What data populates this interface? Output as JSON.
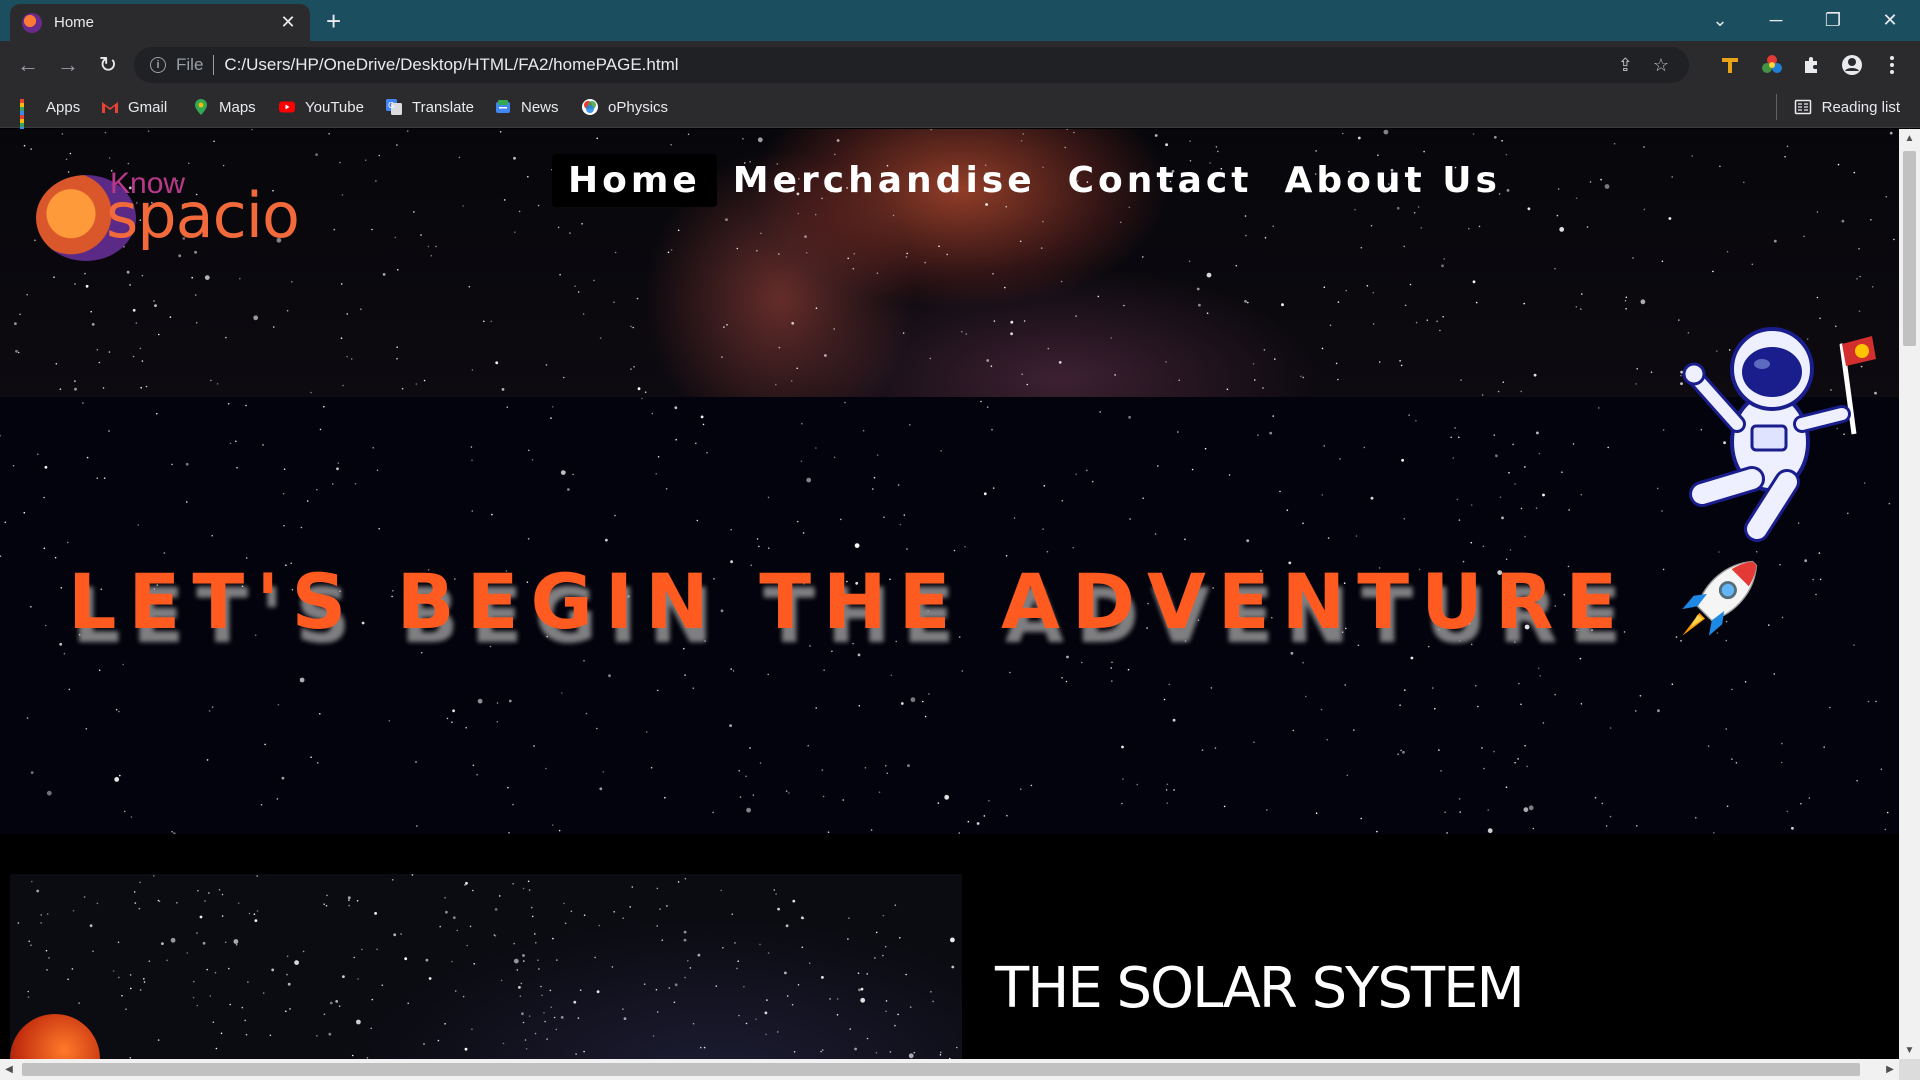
{
  "browser": {
    "tab": {
      "title": "Home",
      "close": "✕"
    },
    "new_tab": "+",
    "window_controls": {
      "list": "⌄",
      "minimize": "─",
      "restore": "❐",
      "close": "✕"
    },
    "nav": {
      "back": "←",
      "forward": "→",
      "reload": "↻"
    },
    "address": {
      "scheme": "File",
      "url": "C:/Users/HP/OneDrive/Desktop/HTML/FA2/homePAGE.html"
    },
    "bookmarks": [
      {
        "label": "Apps",
        "icon": "apps-grid-icon"
      },
      {
        "label": "Gmail",
        "icon": "gmail-icon"
      },
      {
        "label": "Maps",
        "icon": "maps-icon"
      },
      {
        "label": "YouTube",
        "icon": "youtube-icon"
      },
      {
        "label": "Translate",
        "icon": "translate-icon"
      },
      {
        "label": "News",
        "icon": "news-icon"
      },
      {
        "label": "oPhysics",
        "icon": "ophysics-icon"
      }
    ],
    "reading_list": "Reading list"
  },
  "page": {
    "logo": {
      "small": "Know",
      "big": "spacio"
    },
    "nav": [
      "Home",
      "Merchandise",
      "Contact",
      "About Us"
    ],
    "active_nav": "Home",
    "headline": "LET'S BEGIN THE ADVENTURE",
    "section_title": "THE SOLAR SYSTEM"
  },
  "colors": {
    "tabstrip": "#1b4f60",
    "toolbar": "#2b2b2d",
    "accent_orange": "#ff5a1f",
    "logo_orange": "#f26a3b",
    "logo_purple": "#b8398a"
  }
}
